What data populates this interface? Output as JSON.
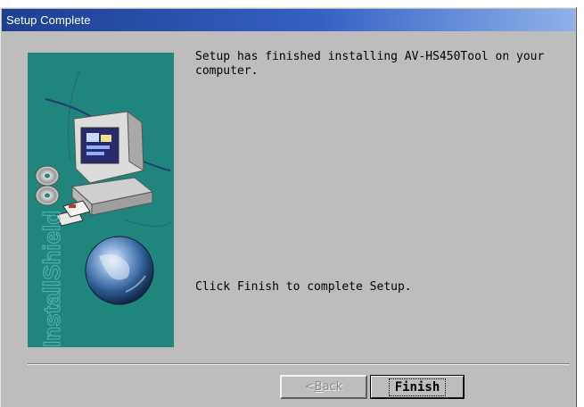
{
  "window": {
    "title": "Setup Complete"
  },
  "banner": {
    "watermark": "InstallShield"
  },
  "content": {
    "message_top": "Setup has finished installing AV-HS450Tool on your\ncomputer.",
    "message_bottom": "Click Finish to complete Setup."
  },
  "buttons": {
    "back_prefix": "< ",
    "back_accel": "B",
    "back_rest": "ack",
    "back_enabled": false,
    "finish_label": "Finish"
  },
  "icons": {
    "banner_art": "installshield-computer-globe-icon"
  },
  "colors": {
    "dialog_bg": "#bdbdbd",
    "title_bar": "#1e3f8f",
    "banner_teal": "#1f857d"
  }
}
